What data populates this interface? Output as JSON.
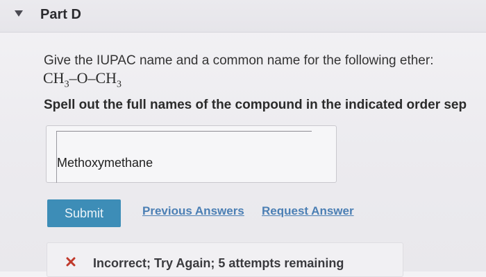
{
  "header": {
    "title": "Part D"
  },
  "question": {
    "prompt": "Give the IUPAC name and a common name for the following ether:",
    "formula": {
      "left_group": "CH",
      "left_sub": "3",
      "bond1": "–",
      "oxygen": "O",
      "bond2": "–",
      "right_group": "CH",
      "right_sub": "3"
    },
    "instructions": "Spell out the full names of the compound in the indicated order sep"
  },
  "answer": {
    "value": "Methoxymethane"
  },
  "actions": {
    "submit_label": "Submit",
    "previous_answers_label": "Previous Answers",
    "request_answer_label": "Request Answer"
  },
  "feedback": {
    "icon": "x-mark-icon",
    "text": "Incorrect; Try Again; 5 attempts remaining",
    "color": "#c0392b"
  },
  "colors": {
    "accent": "#3d8db7",
    "link": "#4b7fb4"
  }
}
